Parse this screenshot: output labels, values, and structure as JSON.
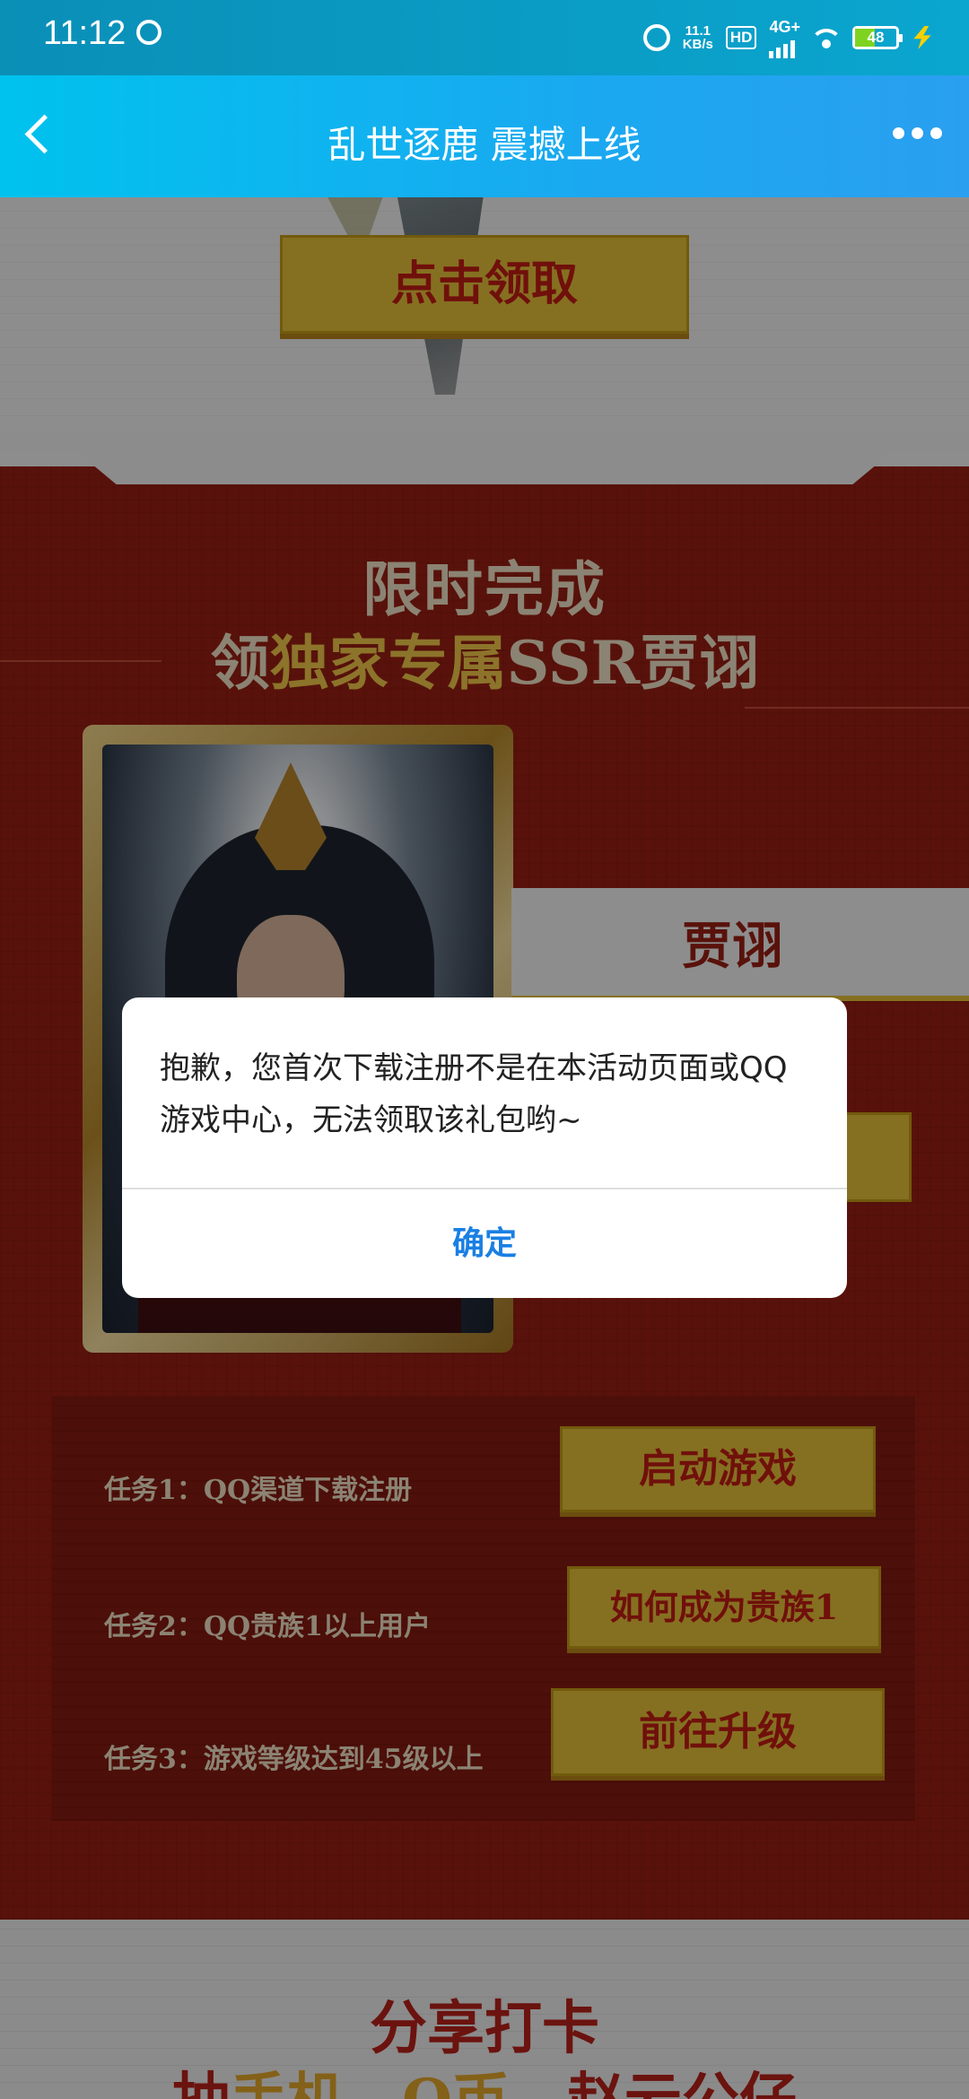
{
  "status_bar": {
    "time": "11:12",
    "net_speed_value": "11.1",
    "net_speed_unit": "KB/s",
    "hd_label": "HD",
    "network_type": "4G+",
    "battery_level": "48",
    "battery_fraction": 0.48,
    "accent_color": "#0a9ac2"
  },
  "nav": {
    "title": "乱世逐鹿 震撼上线",
    "back_icon": "chevron-left-icon",
    "more_icon": "more-dots-icon"
  },
  "page": {
    "claim_button": "点击领取",
    "headline_line1": "限时完成",
    "headline_line2_prefix": "领",
    "headline_line2_highlight": "独家专属",
    "headline_line2_suffix": "SSR贾诩",
    "hero_name": "贾诩",
    "tasks": [
      {
        "label": "任务1：QQ渠道下载注册",
        "button": "启动游戏"
      },
      {
        "label": "任务2：QQ贵族1以上用户",
        "button": "如何成为贵族1"
      },
      {
        "label": "任务3：游戏等级达到45级以上",
        "button": "前往升级"
      }
    ],
    "share_title": "分享打卡",
    "share_sub_prefix": "抽",
    "share_sub_highlight": "手机、Q币",
    "share_sub_suffix": "、赵云公仔"
  },
  "dialog": {
    "message": "抱歉，您首次下载注册不是在本活动页面或QQ游戏中心，无法领取该礼包哟~",
    "confirm_label": "确定",
    "confirm_color": "#1a7fe3"
  }
}
